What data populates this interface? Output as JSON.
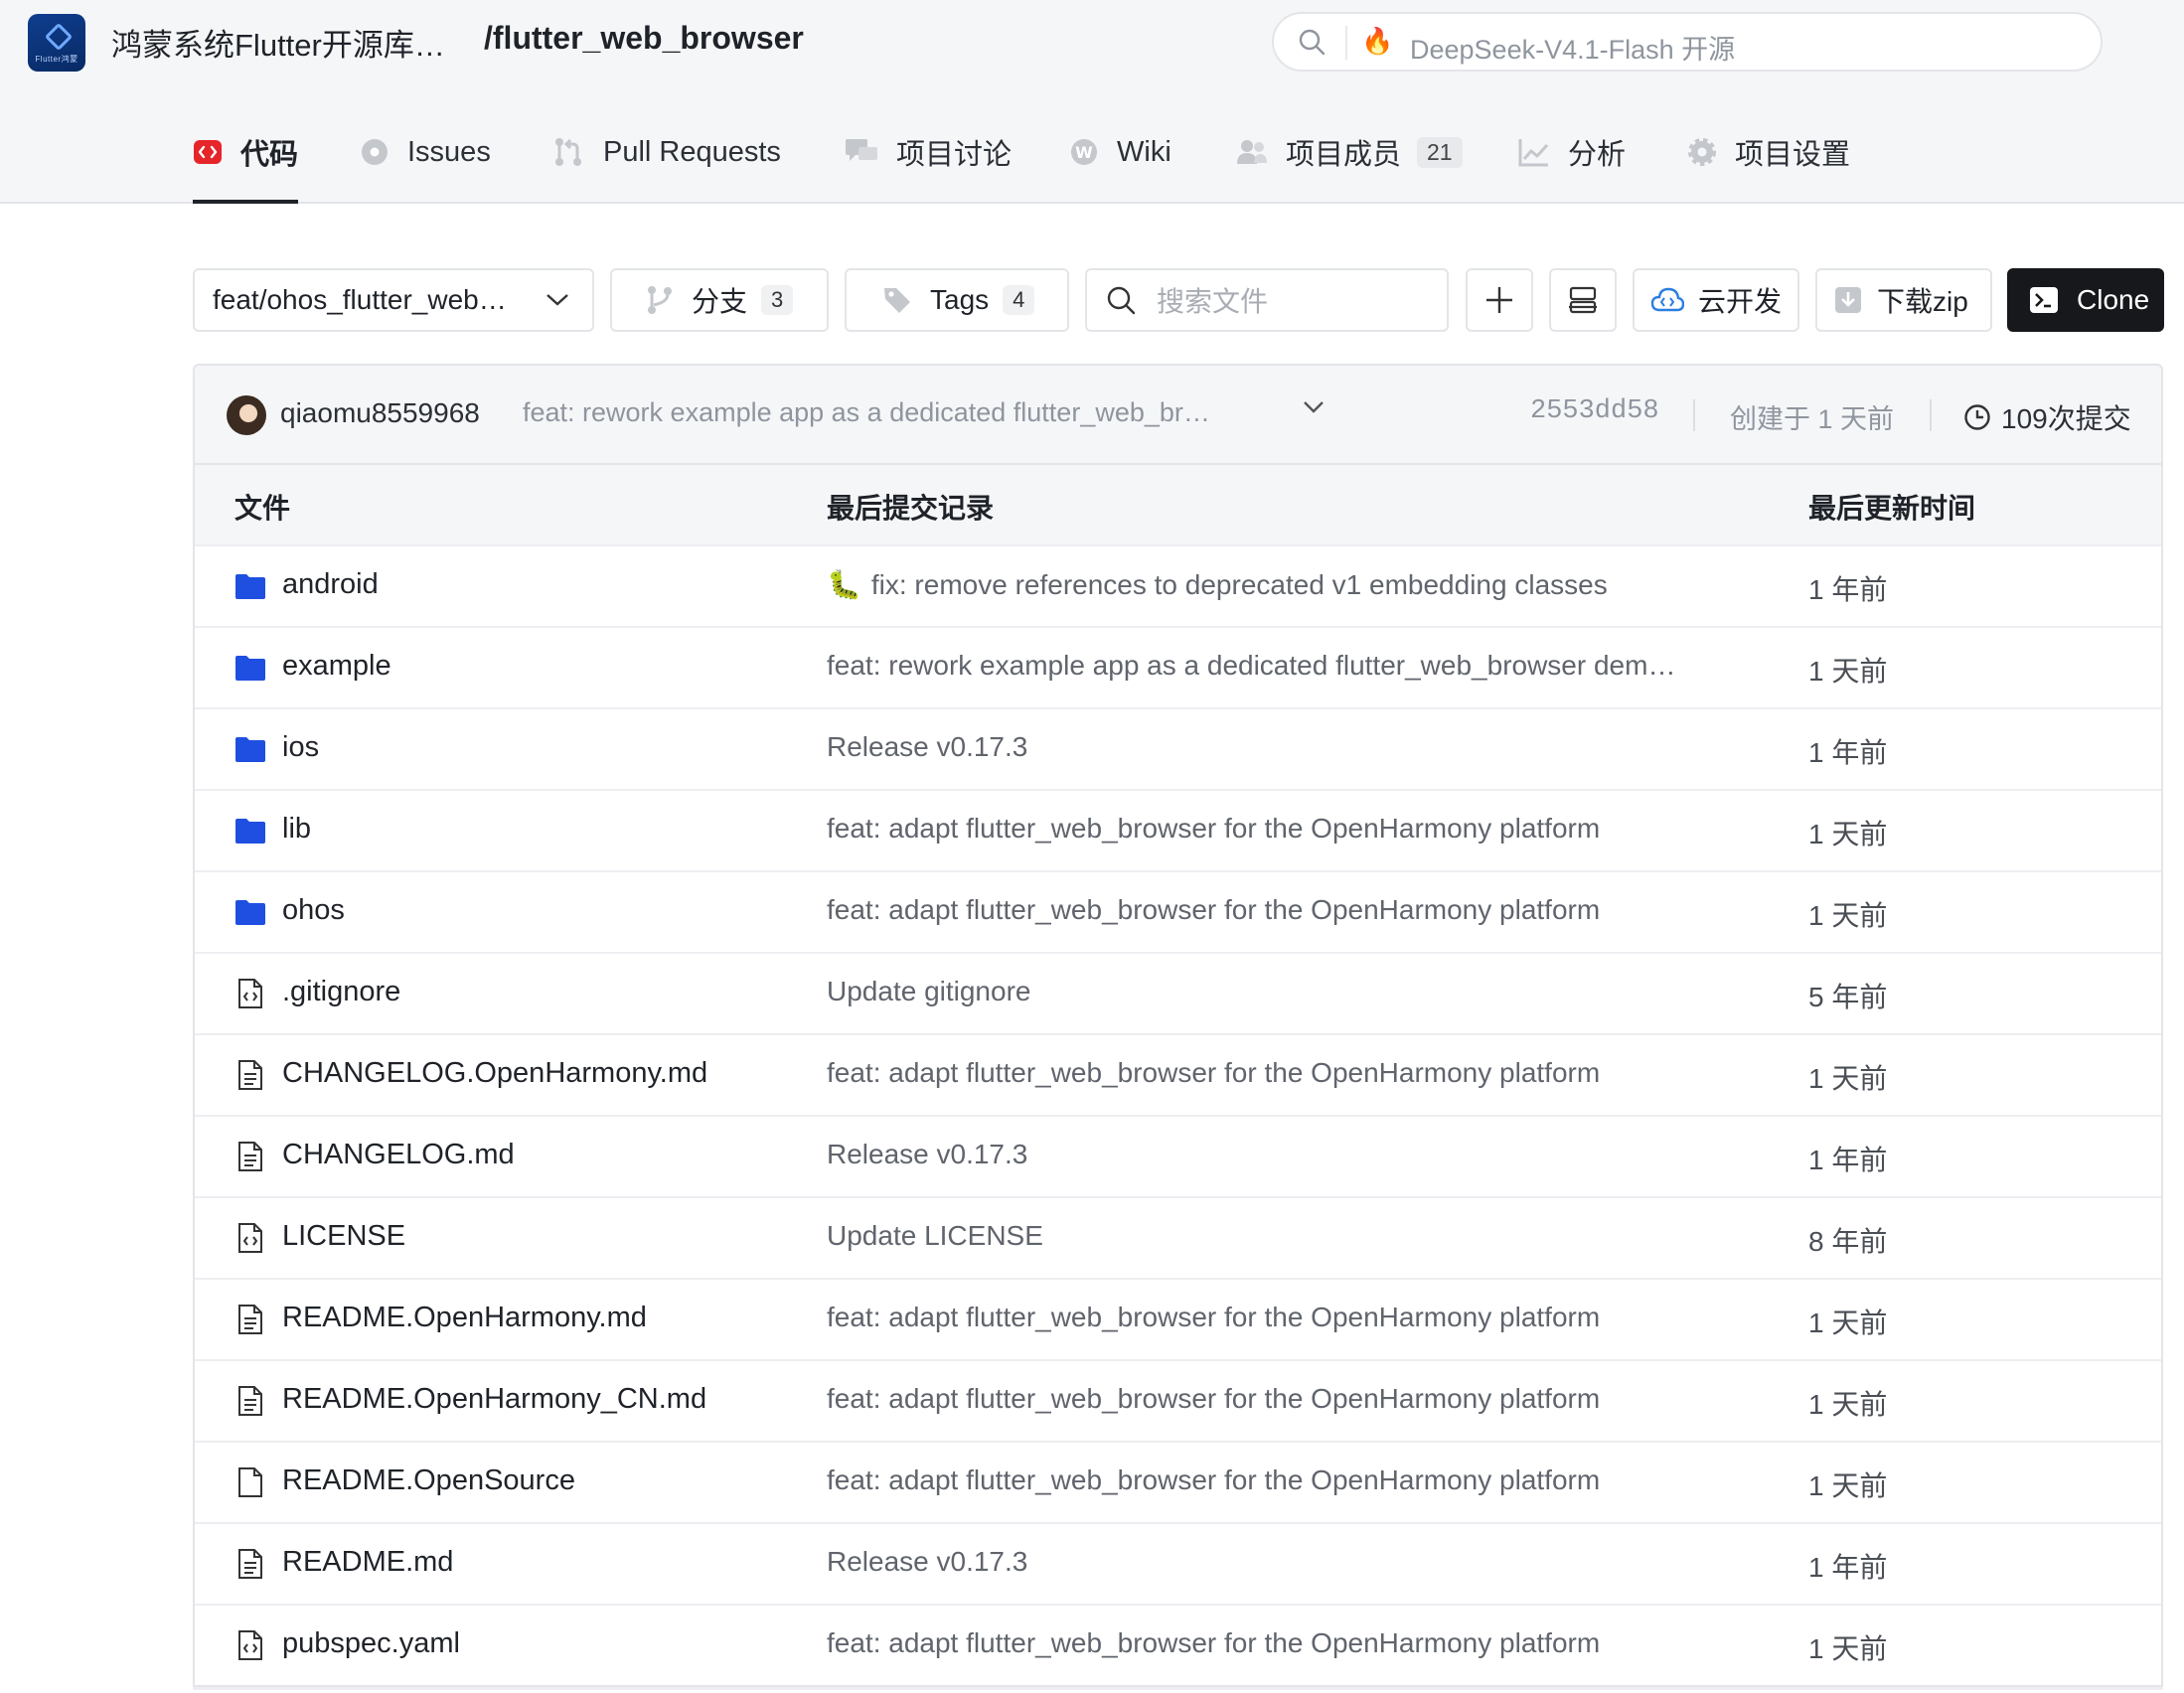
{
  "header": {
    "org_name": "鸿蒙系统Flutter开源库…",
    "repo_name": "/flutter_web_browser",
    "logo_text": "Flutter鸿蒙",
    "search_hint": "DeepSeek-V4.1-Flash 开源"
  },
  "tabs": [
    {
      "label": "代码",
      "icon": "code-icon",
      "active": true
    },
    {
      "label": "Issues",
      "icon": "issues-icon"
    },
    {
      "label": "Pull Requests",
      "icon": "pull-request-icon"
    },
    {
      "label": "项目讨论",
      "icon": "discussion-icon"
    },
    {
      "label": "Wiki",
      "icon": "wiki-icon"
    },
    {
      "label": "项目成员",
      "icon": "members-icon",
      "count": "21"
    },
    {
      "label": "分析",
      "icon": "analytics-icon"
    },
    {
      "label": "项目设置",
      "icon": "settings-icon"
    }
  ],
  "toolbar": {
    "branch": "feat/ohos_flutter_web…",
    "branches_label": "分支",
    "branches_count": "3",
    "tags_label": "Tags",
    "tags_count": "4",
    "search_placeholder": "搜索文件",
    "cloud_label": "云开发",
    "download_label": "下载zip",
    "clone_label": "Clone"
  },
  "commit": {
    "user": "qiaomu8559968",
    "message": "feat: rework example app as a dedicated flutter_web_br…",
    "hash": "2553dd58",
    "created": "创建于 1 天前",
    "count": "109次提交"
  },
  "table": {
    "col_file": "文件",
    "col_commit": "最后提交记录",
    "col_time": "最后更新时间",
    "rows": [
      {
        "type": "folder",
        "name": "android",
        "msg": "fix: remove references to deprecated v1 embedding classes",
        "emoji": "🐛",
        "time": "1 年前"
      },
      {
        "type": "folder",
        "name": "example",
        "msg": "feat: rework example app as a dedicated flutter_web_browser dem…",
        "time": "1 天前"
      },
      {
        "type": "folder",
        "name": "ios",
        "msg": "Release v0.17.3",
        "time": "1 年前"
      },
      {
        "type": "folder",
        "name": "lib",
        "msg": "feat: adapt flutter_web_browser for the OpenHarmony platform",
        "time": "1 天前"
      },
      {
        "type": "folder",
        "name": "ohos",
        "msg": "feat: adapt flutter_web_browser for the OpenHarmony platform",
        "time": "1 天前"
      },
      {
        "type": "code",
        "name": ".gitignore",
        "msg": "Update gitignore",
        "time": "5 年前"
      },
      {
        "type": "doc",
        "name": "CHANGELOG.OpenHarmony.md",
        "msg": "feat: adapt flutter_web_browser for the OpenHarmony platform",
        "time": "1 天前"
      },
      {
        "type": "doc",
        "name": "CHANGELOG.md",
        "msg": "Release v0.17.3",
        "time": "1 年前"
      },
      {
        "type": "code",
        "name": "LICENSE",
        "msg": "Update LICENSE",
        "time": "8 年前"
      },
      {
        "type": "doc",
        "name": "README.OpenHarmony.md",
        "msg": "feat: adapt flutter_web_browser for the OpenHarmony platform",
        "time": "1 天前"
      },
      {
        "type": "doc",
        "name": "README.OpenHarmony_CN.md",
        "msg": "feat: adapt flutter_web_browser for the OpenHarmony platform",
        "time": "1 天前"
      },
      {
        "type": "blank",
        "name": "README.OpenSource",
        "msg": "feat: adapt flutter_web_browser for the OpenHarmony platform",
        "time": "1 天前"
      },
      {
        "type": "doc",
        "name": "README.md",
        "msg": "Release v0.17.3",
        "time": "1 年前"
      },
      {
        "type": "code",
        "name": "pubspec.yaml",
        "msg": "feat: adapt flutter_web_browser for the OpenHarmony platform",
        "time": "1 天前"
      }
    ]
  },
  "colors": {
    "accent_red": "#e5252a",
    "folder_blue": "#1f4fe0",
    "clone_bg": "#16181b"
  }
}
